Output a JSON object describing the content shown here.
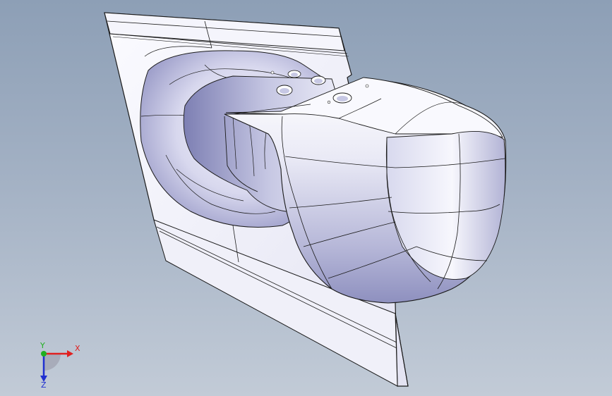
{
  "viewport": {
    "background_top": "#8d9fb6",
    "background_bottom": "#c2cbd7"
  },
  "model": {
    "face_color": "#f2f2fb",
    "shade_color": "#a9aad0",
    "edge_color": "#1a1a1a"
  },
  "triad": {
    "x_label": "X",
    "y_label": "Y",
    "z_label": "Z",
    "x_color": "#e02020",
    "y_color": "#20b020",
    "z_color": "#2030d0"
  }
}
